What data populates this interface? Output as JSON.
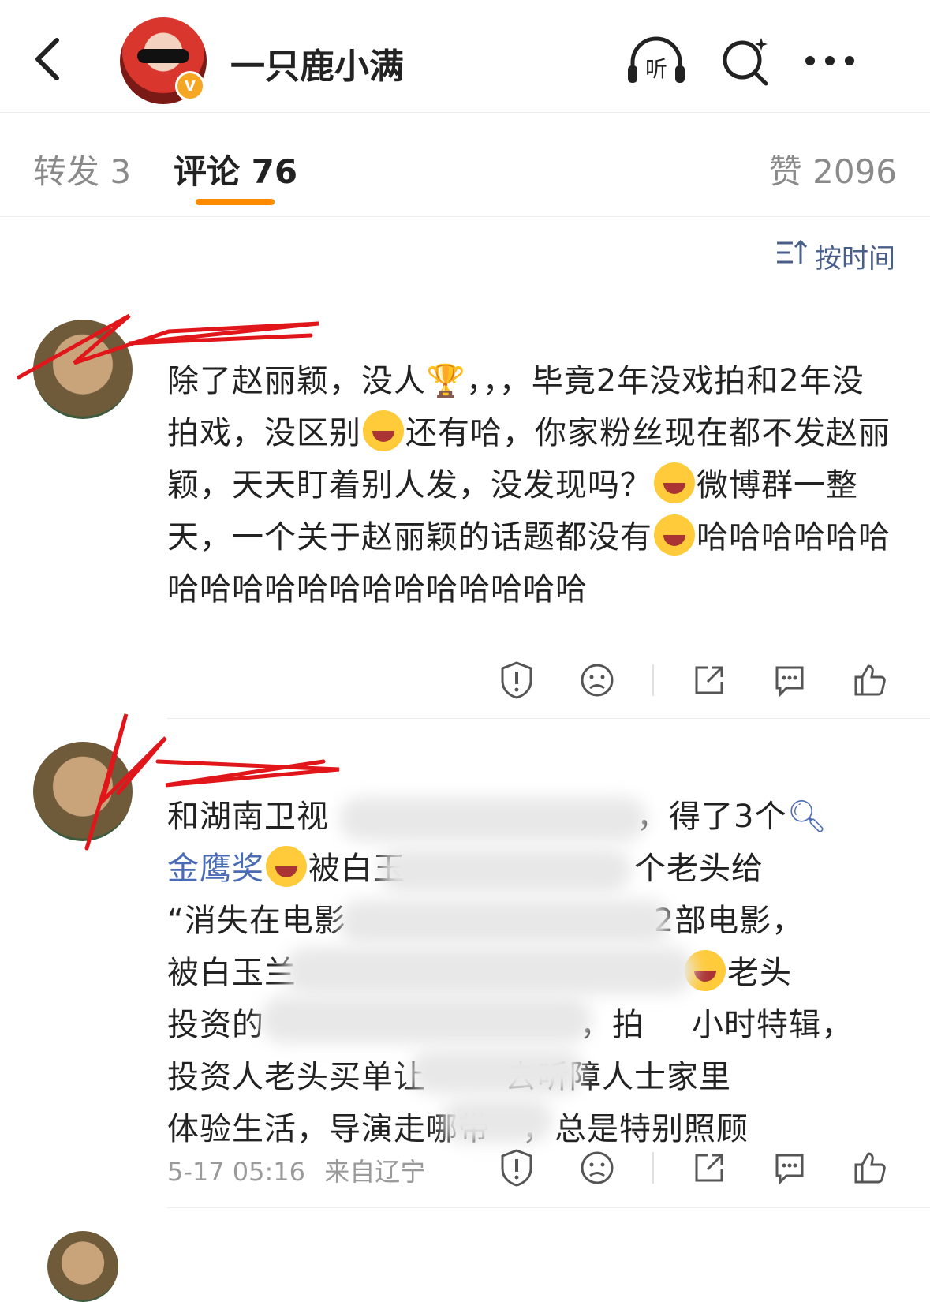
{
  "header": {
    "title": "一只鹿小满",
    "verified_badge": "V",
    "icons": [
      "back-arrow-icon",
      "listen-headphones-icon",
      "search-icon",
      "more-icon"
    ],
    "listen_label": "听"
  },
  "tabs": {
    "repost": "转发 3",
    "comment": "评论 76",
    "like": "赞 2096",
    "active": "comment",
    "accent": "#ff8a00"
  },
  "sort": {
    "label": "按时间",
    "icon": "sort-icon"
  },
  "comments": [
    {
      "text_part1": "除了赵丽颖，没人",
      "text_part2": "，，，毕竟2年没戏拍和2年没拍戏，没区别",
      "text_part3": "还有哈，你家粉丝现在都不发赵丽颖，天天盯着别人发，没发现吗？",
      "text_part4": "微博群一整天，一个关于赵丽颖的话题都没有",
      "text_part5": "哈哈哈哈哈哈哈哈哈哈哈哈哈哈哈哈哈哈哈"
    },
    {
      "line1_a": "和湖南卫视",
      "line1_b": "，得了3个",
      "line2_link": "金鹰奖",
      "line2_b": "被白玉",
      "line2_c": "个老头给",
      "line3_a": "“消失在电影",
      "line3_b": "2部电影，",
      "line4_a": "被白玉兰",
      "line4_b": "老头",
      "line5_a": "投资的",
      "line5_b": "，拍",
      "line5_c": "小时特辑，",
      "line6_a": "投资人老头买单让",
      "line6_b": "去听障人士家里",
      "line7": "体验生活，导演走哪带",
      "line7_b": "，总是特别照顾",
      "date": "5-17 05:16",
      "location": "来自辽宁"
    }
  ]
}
